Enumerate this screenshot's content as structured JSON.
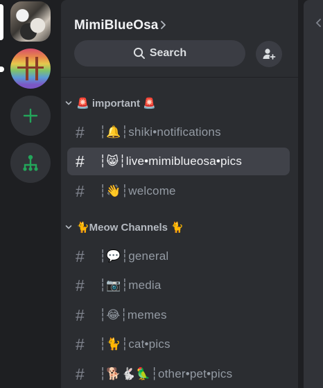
{
  "servers": [
    {
      "name": "cat-server-icon",
      "selected": true
    },
    {
      "name": "rainbow-bridge-server-icon",
      "unread": true
    }
  ],
  "rail_actions": {
    "add_server_icon": "plus-icon",
    "discover_icon": "discover-hub-icon",
    "accent": "#23a55a"
  },
  "header": {
    "guild_name": "MimiBlueOsa",
    "search_label": "Search",
    "invite_icon": "add-person-icon"
  },
  "categories": [
    {
      "label": "🚨 important 🚨",
      "channels": [
        {
          "label": "┆🔔┆shiki•notifications",
          "active": false
        },
        {
          "label": "┆😸┆live•mimiblueosa•pics",
          "active": true
        },
        {
          "label": "┆👋┆welcome",
          "active": false
        }
      ]
    },
    {
      "label": "🐈Meow Channels 🐈",
      "channels": [
        {
          "label": "┆💬┆general",
          "active": false
        },
        {
          "label": "┆📷┆media",
          "active": false
        },
        {
          "label": "┆😂┆memes",
          "active": false
        },
        {
          "label": "┆🐈┆cat•pics",
          "active": false
        },
        {
          "label": "┆🐕🐇🦜┆other•pet•pics",
          "active": false
        }
      ]
    }
  ],
  "colors": {
    "sidebar_bg": "#2b2d31",
    "rail_bg": "#1e1f22",
    "active_row": "#404249",
    "muted_text": "#949ba4"
  }
}
